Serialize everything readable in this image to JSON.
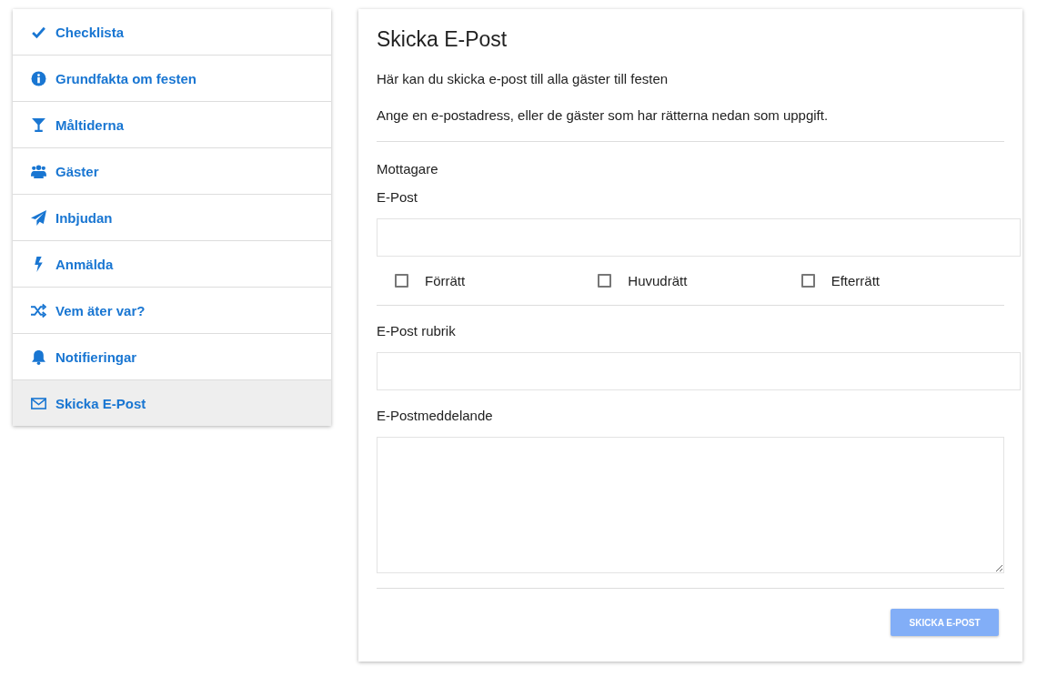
{
  "sidebar": {
    "items": [
      {
        "label": "Checklista",
        "selected": false
      },
      {
        "label": "Grundfakta om festen",
        "selected": false
      },
      {
        "label": "Måltiderna",
        "selected": false
      },
      {
        "label": "Gäster",
        "selected": false
      },
      {
        "label": "Inbjudan",
        "selected": false
      },
      {
        "label": "Anmälda",
        "selected": false
      },
      {
        "label": "Vem äter var?",
        "selected": false
      },
      {
        "label": "Notifieringar",
        "selected": false
      },
      {
        "label": "Skicka E-Post",
        "selected": true
      }
    ]
  },
  "card": {
    "title": "Skicka E-Post",
    "intro": [
      "Här kan du skicka e-post till alla gäster till festen",
      "Ange en e-postadress, eller de gäster som har rätterna nedan som uppgift."
    ],
    "recipients_heading": "Mottagare",
    "email_label": "E-Post",
    "courses": [
      {
        "label": "Förrätt",
        "checked": false
      },
      {
        "label": "Huvudrätt",
        "checked": false
      },
      {
        "label": "Efterrätt",
        "checked": false
      }
    ],
    "subject_label": "E-Post rubrik",
    "message_label": "E-Postmeddelande",
    "send_button": {
      "label": "SKICKA E-POST",
      "disabled": true
    }
  }
}
